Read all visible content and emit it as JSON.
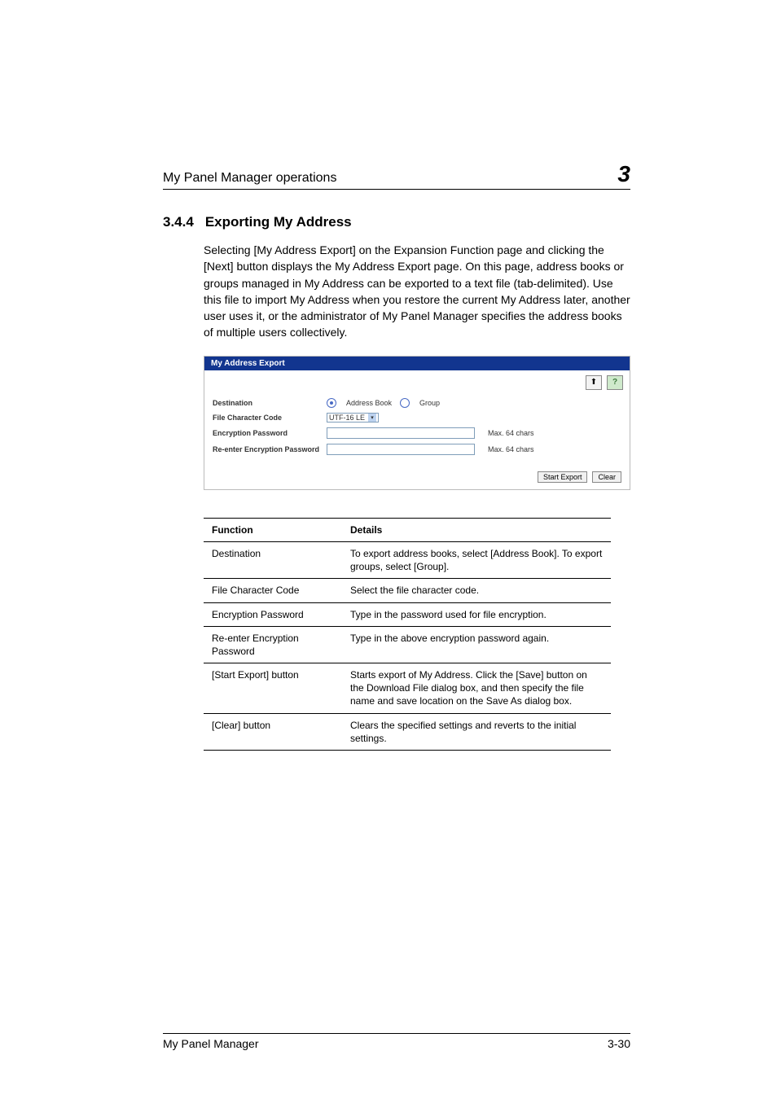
{
  "run_head": {
    "title": "My Panel Manager operations",
    "chapter_num": "3"
  },
  "section": {
    "num": "3.4.4",
    "title": "Exporting My Address"
  },
  "body_paragraph": "Selecting [My Address Export] on the Expansion Function page and clicking the [Next] button displays the My Address Export page. On this page, address books or groups managed in My Address can be exported to a text file (tab-delimited). Use this file to import My Address when you restore the current My Address later, another user uses it, or the administrator of My Panel Manager specifies the address books of multiple users collectively.",
  "shot": {
    "title": "My Address Export",
    "help_glyph": "?",
    "labels": {
      "destination": "Destination",
      "file_char_code": "File Character Code",
      "enc_pw": "Encryption Password",
      "reenter_pw": "Re-enter Encryption Password"
    },
    "radio": {
      "address_book": "Address Book",
      "group": "Group"
    },
    "select_value": "UTF-16 LE",
    "hint": "Max. 64 chars",
    "buttons": {
      "start_export": "Start Export",
      "clear": "Clear"
    }
  },
  "table": {
    "head": {
      "function": "Function",
      "details": "Details"
    },
    "rows": [
      {
        "function": "Destination",
        "details": "To export address books, select [Address Book]. To export groups, select [Group]."
      },
      {
        "function": "File Character Code",
        "details": "Select the file character code."
      },
      {
        "function": "Encryption Password",
        "details": "Type in the password used for file encryption."
      },
      {
        "function": "Re-enter Encryption Password",
        "details": "Type in the above encryption password again."
      },
      {
        "function": "[Start Export] button",
        "details": "Starts export of My Address. Click the [Save] button on the Download File dialog box, and then specify the file name and save location on the Save As dialog box."
      },
      {
        "function": "[Clear] button",
        "details": "Clears the specified settings and reverts to the initial settings."
      }
    ]
  },
  "footer": {
    "product": "My Panel Manager",
    "page": "3-30"
  },
  "chart_data": {
    "type": "table",
    "note": "Primary tabular data is represented under the 'table' key."
  }
}
